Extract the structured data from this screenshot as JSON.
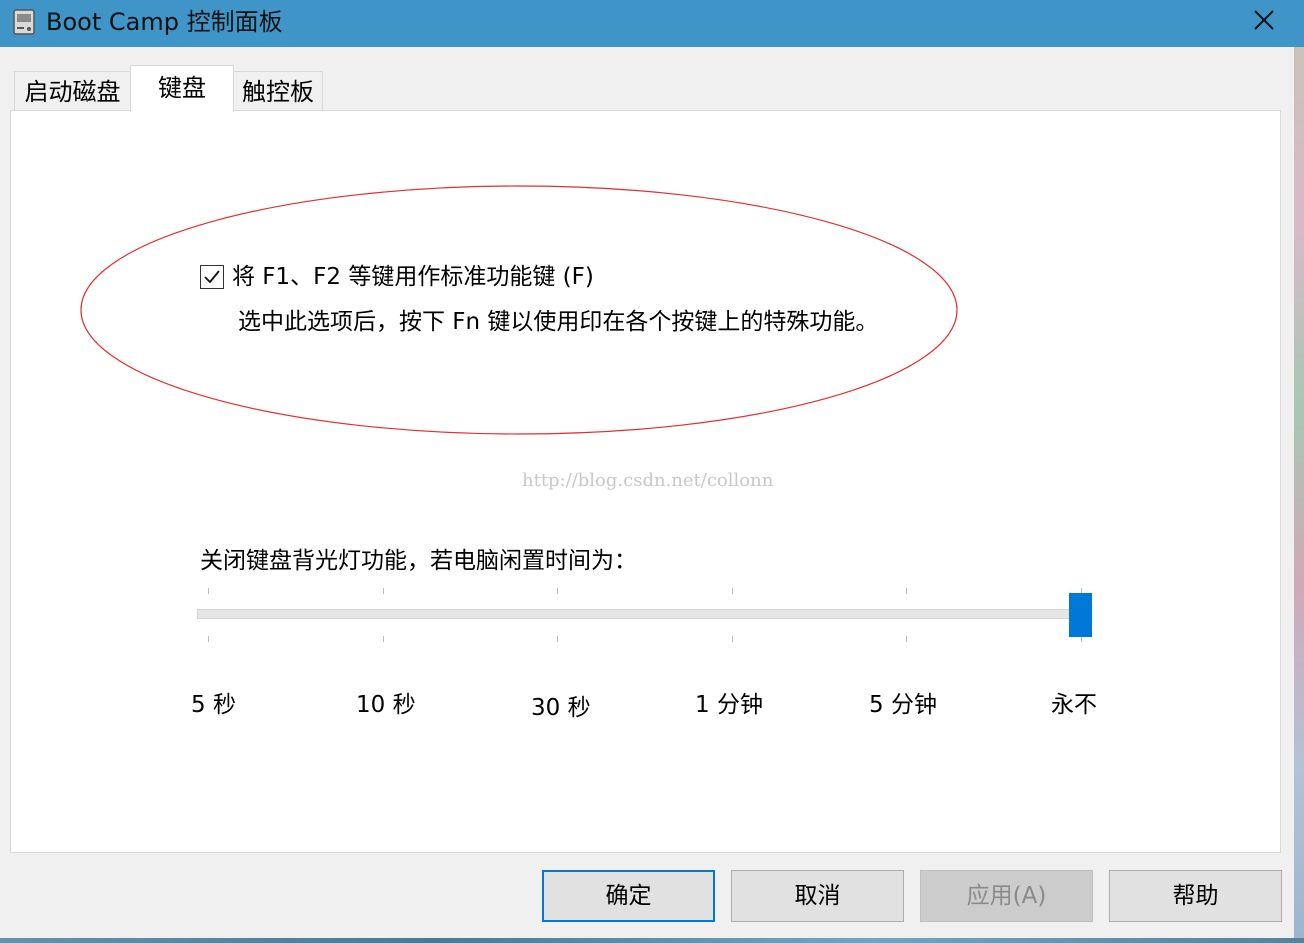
{
  "window": {
    "title": "Boot Camp 控制面板",
    "title_bar_color": "#3f94c8",
    "title_icon": "drive-icon",
    "close_icon": "close-icon"
  },
  "tabs": [
    {
      "label": "启动磁盘",
      "selected": false
    },
    {
      "label": "键盘",
      "selected": true
    },
    {
      "label": "触控板",
      "selected": false
    }
  ],
  "keyboard": {
    "fn_option": {
      "checked": true,
      "label": "将 F1、F2 等键用作标准功能键 (F)",
      "description": "选中此选项后，按下 Fn 键以使用印在各个按键上的特殊功能。"
    },
    "watermark": "http://blog.csdn.net/collonn",
    "backlight": {
      "label": "关闭键盘背光灯功能，若电脑闲置时间为：",
      "stops": [
        "5 秒",
        "10 秒",
        "30 秒",
        "1 分钟",
        "5 分钟",
        "永不"
      ],
      "selected_index": 5,
      "accent_color": "#0078d7"
    }
  },
  "annotation": {
    "shape": "ellipse",
    "color": "#e03030"
  },
  "buttons": {
    "ok": "确定",
    "cancel": "取消",
    "apply": "应用(A)",
    "apply_enabled": false,
    "help": "帮助"
  }
}
